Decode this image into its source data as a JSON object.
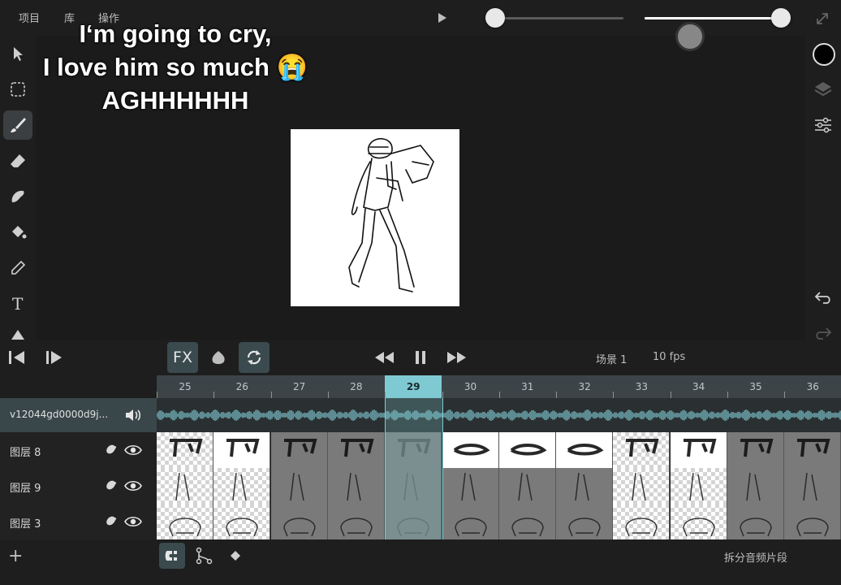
{
  "menu": {
    "items": [
      "项目",
      "库",
      "操作"
    ]
  },
  "sliders": {
    "brush_size": 0.08,
    "opacity": 1.0
  },
  "caption": {
    "line1": "I‘m going to cry,",
    "line2": "I love him so much 😭",
    "line3": "AGHHHHHH"
  },
  "tools": [
    "select-icon",
    "marquee-icon",
    "brush-icon",
    "eraser-icon",
    "lasso-fill-icon",
    "fill-bucket-icon",
    "eyedropper-icon",
    "text-icon",
    "shape-icon"
  ],
  "active_tool": "brush",
  "color": {
    "current": "#000000",
    "accent": "#7fcad2"
  },
  "playback": {
    "fx_label": "FX",
    "scene": "场景 1",
    "fps": "10 fps"
  },
  "timeline": {
    "frames": [
      "25",
      "26",
      "27",
      "28",
      "29",
      "30",
      "31",
      "32",
      "33",
      "34",
      "35",
      "36"
    ],
    "current_frame": "29",
    "audio_track": "v12044gd0000d9j...",
    "layers": [
      {
        "name": "图层 8"
      },
      {
        "name": "图层 9"
      },
      {
        "name": "图层 3"
      }
    ]
  },
  "bottom": {
    "split_audio": "拆分音频片段",
    "add": "+"
  }
}
